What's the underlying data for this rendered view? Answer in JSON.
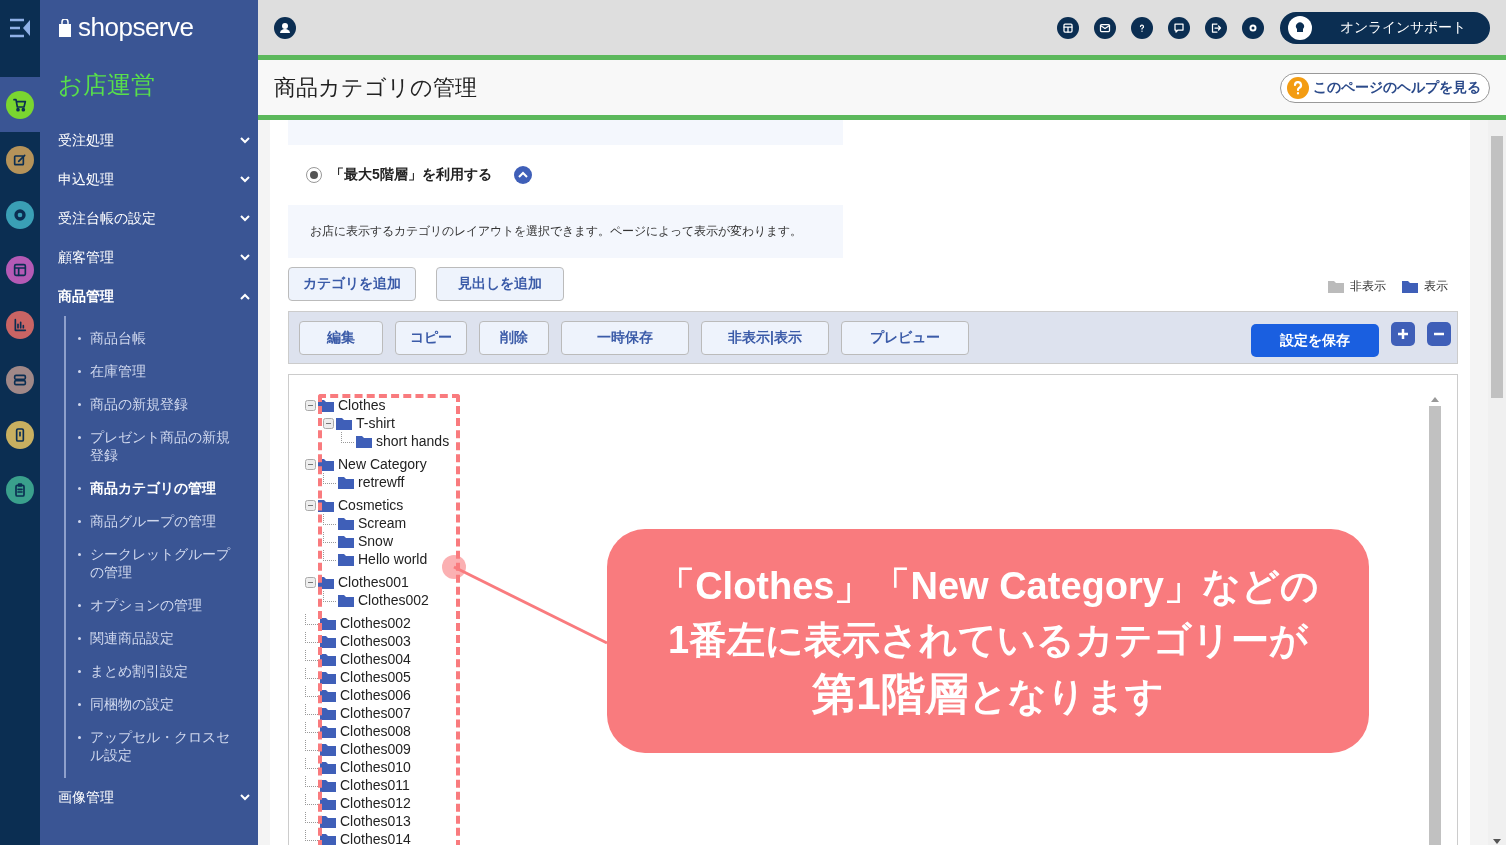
{
  "rail": [
    {
      "kind": "cart",
      "color": "#7ad630",
      "selected": true
    },
    {
      "kind": "edit",
      "color": "#b5935a",
      "selected": false
    },
    {
      "kind": "gear",
      "color": "#3a9fb5",
      "selected": false
    },
    {
      "kind": "layout",
      "color": "#b45ab5",
      "selected": false
    },
    {
      "kind": "chart",
      "color": "#c96464",
      "selected": false
    },
    {
      "kind": "server",
      "color": "#a08888",
      "selected": false
    },
    {
      "kind": "phone",
      "color": "#c8b060",
      "selected": false
    },
    {
      "kind": "clipboard",
      "color": "#3aa08c",
      "selected": false
    }
  ],
  "sidebar": {
    "logo": "shopserve",
    "section": "お店運営",
    "menu": [
      {
        "label": "受注処理",
        "expanded": false
      },
      {
        "label": "申込処理",
        "expanded": false
      },
      {
        "label": "受注台帳の設定",
        "expanded": false
      },
      {
        "label": "顧客管理",
        "expanded": false
      },
      {
        "label": "商品管理",
        "expanded": true,
        "children": [
          {
            "label": "商品台帳",
            "selected": false
          },
          {
            "label": "在庫管理",
            "selected": false
          },
          {
            "label": "商品の新規登録",
            "selected": false
          },
          {
            "label": "プレゼント商品の新規登録",
            "selected": false
          },
          {
            "label": "商品カテゴリの管理",
            "selected": true
          },
          {
            "label": "商品グループの管理",
            "selected": false
          },
          {
            "label": "シークレットグループの管理",
            "selected": false
          },
          {
            "label": "オプションの管理",
            "selected": false
          },
          {
            "label": "関連商品設定",
            "selected": false
          },
          {
            "label": "まとめ割引設定",
            "selected": false
          },
          {
            "label": "同梱物の設定",
            "selected": false
          },
          {
            "label": "アップセル・クロスセル設定",
            "selected": false
          }
        ]
      },
      {
        "label": "画像管理",
        "expanded": false
      }
    ]
  },
  "topbar": {
    "support_button": "オンラインサポート"
  },
  "page_title": "商品カテゴリの管理",
  "help_link": "このページのヘルプを見る",
  "layout_option": {
    "label": "「最大5階層」を利用する",
    "selected": true,
    "expanded": true
  },
  "info_text": "お店に表示するカテゴリのレイアウトを選択できます。ページによって表示が変わります。",
  "add_buttons": [
    "カテゴリを追加",
    "見出しを追加"
  ],
  "legend": [
    {
      "kind": "hidden",
      "label": "非表示"
    },
    {
      "kind": "shown",
      "label": "表示"
    }
  ],
  "toolbar": {
    "buttons": [
      "編集",
      "コピー",
      "削除",
      "一時保存",
      "非表示|表示",
      "プレビュー"
    ],
    "save_button": "設定を保存"
  },
  "tree": [
    {
      "label": "Clothes",
      "expanded": true,
      "children": [
        {
          "label": "T-shirt",
          "expanded": true,
          "children": [
            {
              "label": "short hands"
            }
          ]
        }
      ]
    },
    {
      "label": "New Category",
      "expanded": true,
      "children": [
        {
          "label": "retrewff"
        }
      ]
    },
    {
      "label": "Cosmetics",
      "expanded": true,
      "children": [
        {
          "label": "Scream"
        },
        {
          "label": "Snow"
        },
        {
          "label": "Hello world"
        }
      ]
    },
    {
      "label": "Clothes001",
      "expanded": true,
      "children": [
        {
          "label": "Clothes002"
        }
      ]
    },
    {
      "label": "Clothes002"
    },
    {
      "label": "Clothes003"
    },
    {
      "label": "Clothes004"
    },
    {
      "label": "Clothes005"
    },
    {
      "label": "Clothes006"
    },
    {
      "label": "Clothes007"
    },
    {
      "label": "Clothes008"
    },
    {
      "label": "Clothes009"
    },
    {
      "label": "Clothes010"
    },
    {
      "label": "Clothes011"
    },
    {
      "label": "Clothes012"
    },
    {
      "label": "Clothes013"
    },
    {
      "label": "Clothes014"
    }
  ],
  "annotation": {
    "lines": [
      "「Clothes」「New Category」などの",
      "1番左に表示されているカテゴリーが",
      "**第1階層**となります"
    ]
  }
}
